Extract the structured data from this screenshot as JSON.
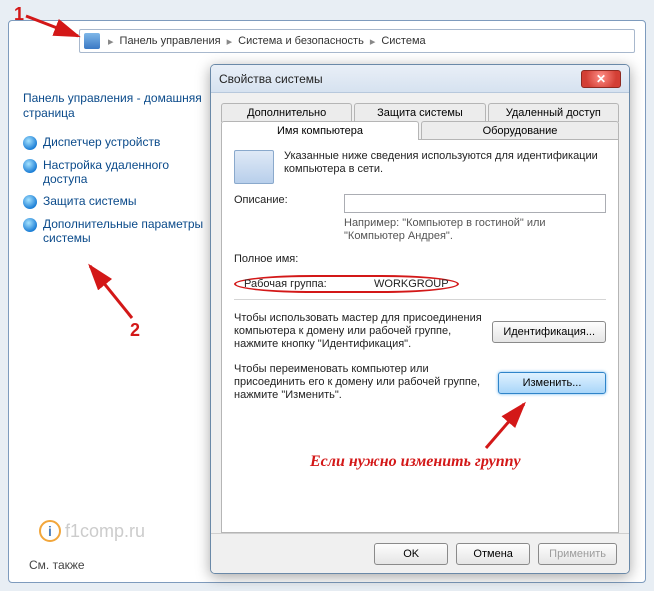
{
  "breadcrumb": {
    "root": "Панель управления",
    "mid": "Система и безопасность",
    "leaf": "Система"
  },
  "sidebar": {
    "home": "Панель управления - домашняя страница",
    "links": [
      "Диспетчер устройств",
      "Настройка удаленного доступа",
      "Защита системы",
      "Дополнительные параметры системы"
    ],
    "see_also": "См. также"
  },
  "watermark": "f1comp.ru",
  "dialog": {
    "title": "Свойства системы",
    "tabs_row1": [
      "Дополнительно",
      "Защита системы",
      "Удаленный доступ"
    ],
    "tabs_row2": [
      "Имя компьютера",
      "Оборудование"
    ],
    "intro": "Указанные ниже сведения используются для идентификации компьютера в сети.",
    "desc_label": "Описание:",
    "desc_value": "",
    "example": "Например: \"Компьютер в гостиной\" или \"Компьютер Андрея\".",
    "fullname_label": "Полное имя:",
    "fullname_value": "",
    "workgroup_label": "Рабочая группа:",
    "workgroup_value": "WORKGROUP",
    "ident_text": "Чтобы использовать мастер для присоединения компьютера к домену или рабочей группе, нажмите кнопку \"Идентификация\".",
    "ident_btn": "Идентификация...",
    "change_text": "Чтобы переименовать компьютер или присоединить его к домену или рабочей группе, нажмите \"Изменить\".",
    "change_btn": "Изменить...",
    "ok": "OK",
    "cancel": "Отмена",
    "apply": "Применить"
  },
  "annotations": {
    "n1": "1",
    "n2": "2",
    "note": "Если нужно изменить группу"
  },
  "colors": {
    "annotation": "#d31818"
  }
}
